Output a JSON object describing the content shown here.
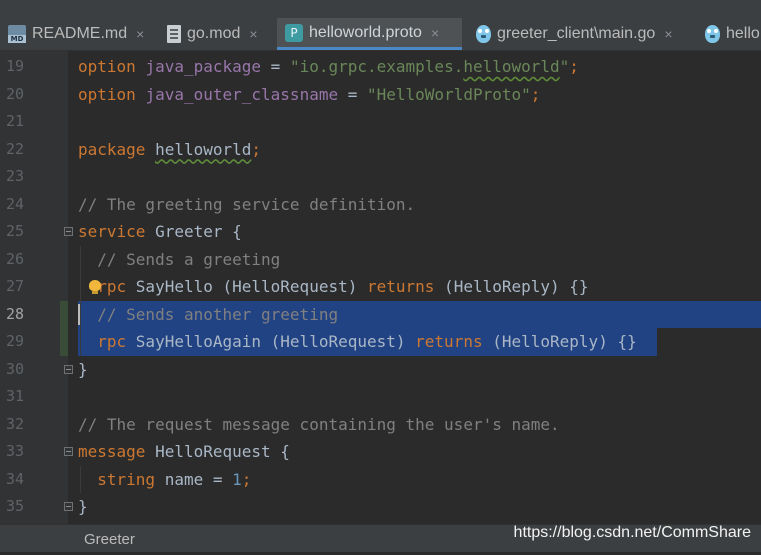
{
  "tabs": [
    {
      "label": "README.md",
      "icon": "markdown-file-icon",
      "active": false
    },
    {
      "label": "go.mod",
      "icon": "text-file-icon",
      "active": false
    },
    {
      "label": "helloworld.proto",
      "icon": "protobuf-file-icon",
      "icon_letter": "P",
      "active": true
    },
    {
      "label": "greeter_client\\main.go",
      "icon": "go-gopher-icon",
      "active": false
    },
    {
      "label": "hello",
      "icon": "go-gopher-icon",
      "active": false
    }
  ],
  "close_glyph": "×",
  "lines": [
    {
      "num": "19",
      "tokens": [
        [
          "k",
          "option "
        ],
        [
          "f",
          "java_package"
        ],
        [
          "t",
          " = "
        ],
        [
          "s",
          "\"io.grpc.examples."
        ],
        [
          "sw",
          "helloworld"
        ],
        [
          "s",
          "\""
        ],
        [
          "k",
          ";"
        ]
      ]
    },
    {
      "num": "20",
      "tokens": [
        [
          "k",
          "option "
        ],
        [
          "f",
          "java_outer_classname"
        ],
        [
          "t",
          " = "
        ],
        [
          "s",
          "\"HelloWorldProto\""
        ],
        [
          "k",
          ";"
        ]
      ]
    },
    {
      "num": "21",
      "tokens": []
    },
    {
      "num": "22",
      "tokens": [
        [
          "k",
          "package "
        ],
        [
          "tw",
          "helloworld"
        ],
        [
          "k",
          ";"
        ]
      ]
    },
    {
      "num": "23",
      "tokens": []
    },
    {
      "num": "24",
      "tokens": [
        [
          "c",
          "// The greeting service definition."
        ]
      ]
    },
    {
      "num": "25",
      "tokens": [
        [
          "k",
          "service "
        ],
        [
          "t",
          "Greeter {"
        ]
      ]
    },
    {
      "num": "26",
      "tokens": [
        [
          "c",
          "  // Sends a greeting"
        ]
      ]
    },
    {
      "num": "27",
      "tokens": [
        [
          "k",
          "  rpc "
        ],
        [
          "t",
          "SayHello (HelloRequest) "
        ],
        [
          "k",
          "returns"
        ],
        [
          "t",
          " (HelloReply) {}"
        ]
      ]
    },
    {
      "num": "28",
      "tokens": [
        [
          "c",
          "  // Sends another greeting"
        ]
      ]
    },
    {
      "num": "29",
      "tokens": [
        [
          "k",
          "  rpc "
        ],
        [
          "t",
          "SayHelloAgain (HelloRequest) "
        ],
        [
          "k",
          "returns"
        ],
        [
          "t",
          " (HelloReply) {}"
        ]
      ]
    },
    {
      "num": "30",
      "tokens": [
        [
          "t",
          "}"
        ]
      ]
    },
    {
      "num": "31",
      "tokens": []
    },
    {
      "num": "32",
      "tokens": [
        [
          "c",
          "// The request message containing the user's name."
        ]
      ]
    },
    {
      "num": "33",
      "tokens": [
        [
          "k",
          "message "
        ],
        [
          "t",
          "HelloRequest {"
        ]
      ]
    },
    {
      "num": "34",
      "tokens": [
        [
          "k",
          "  string "
        ],
        [
          "t",
          "name = "
        ],
        [
          "n",
          "1"
        ],
        [
          "k",
          ";"
        ]
      ]
    },
    {
      "num": "35",
      "tokens": [
        [
          "t",
          "}"
        ]
      ]
    }
  ],
  "current_line": "28",
  "selected_lines": [
    "28",
    "29"
  ],
  "breadcrumb": "Greeter",
  "watermark": "https://blog.csdn.net/CommShare",
  "colors": {
    "background": "#2b2b2b",
    "selection": "#214283",
    "keyword": "#cc7832",
    "string": "#6a8759",
    "number": "#6897bb",
    "field": "#9876aa",
    "comment": "#808080",
    "active_tab_underline": "#4a88c7"
  }
}
